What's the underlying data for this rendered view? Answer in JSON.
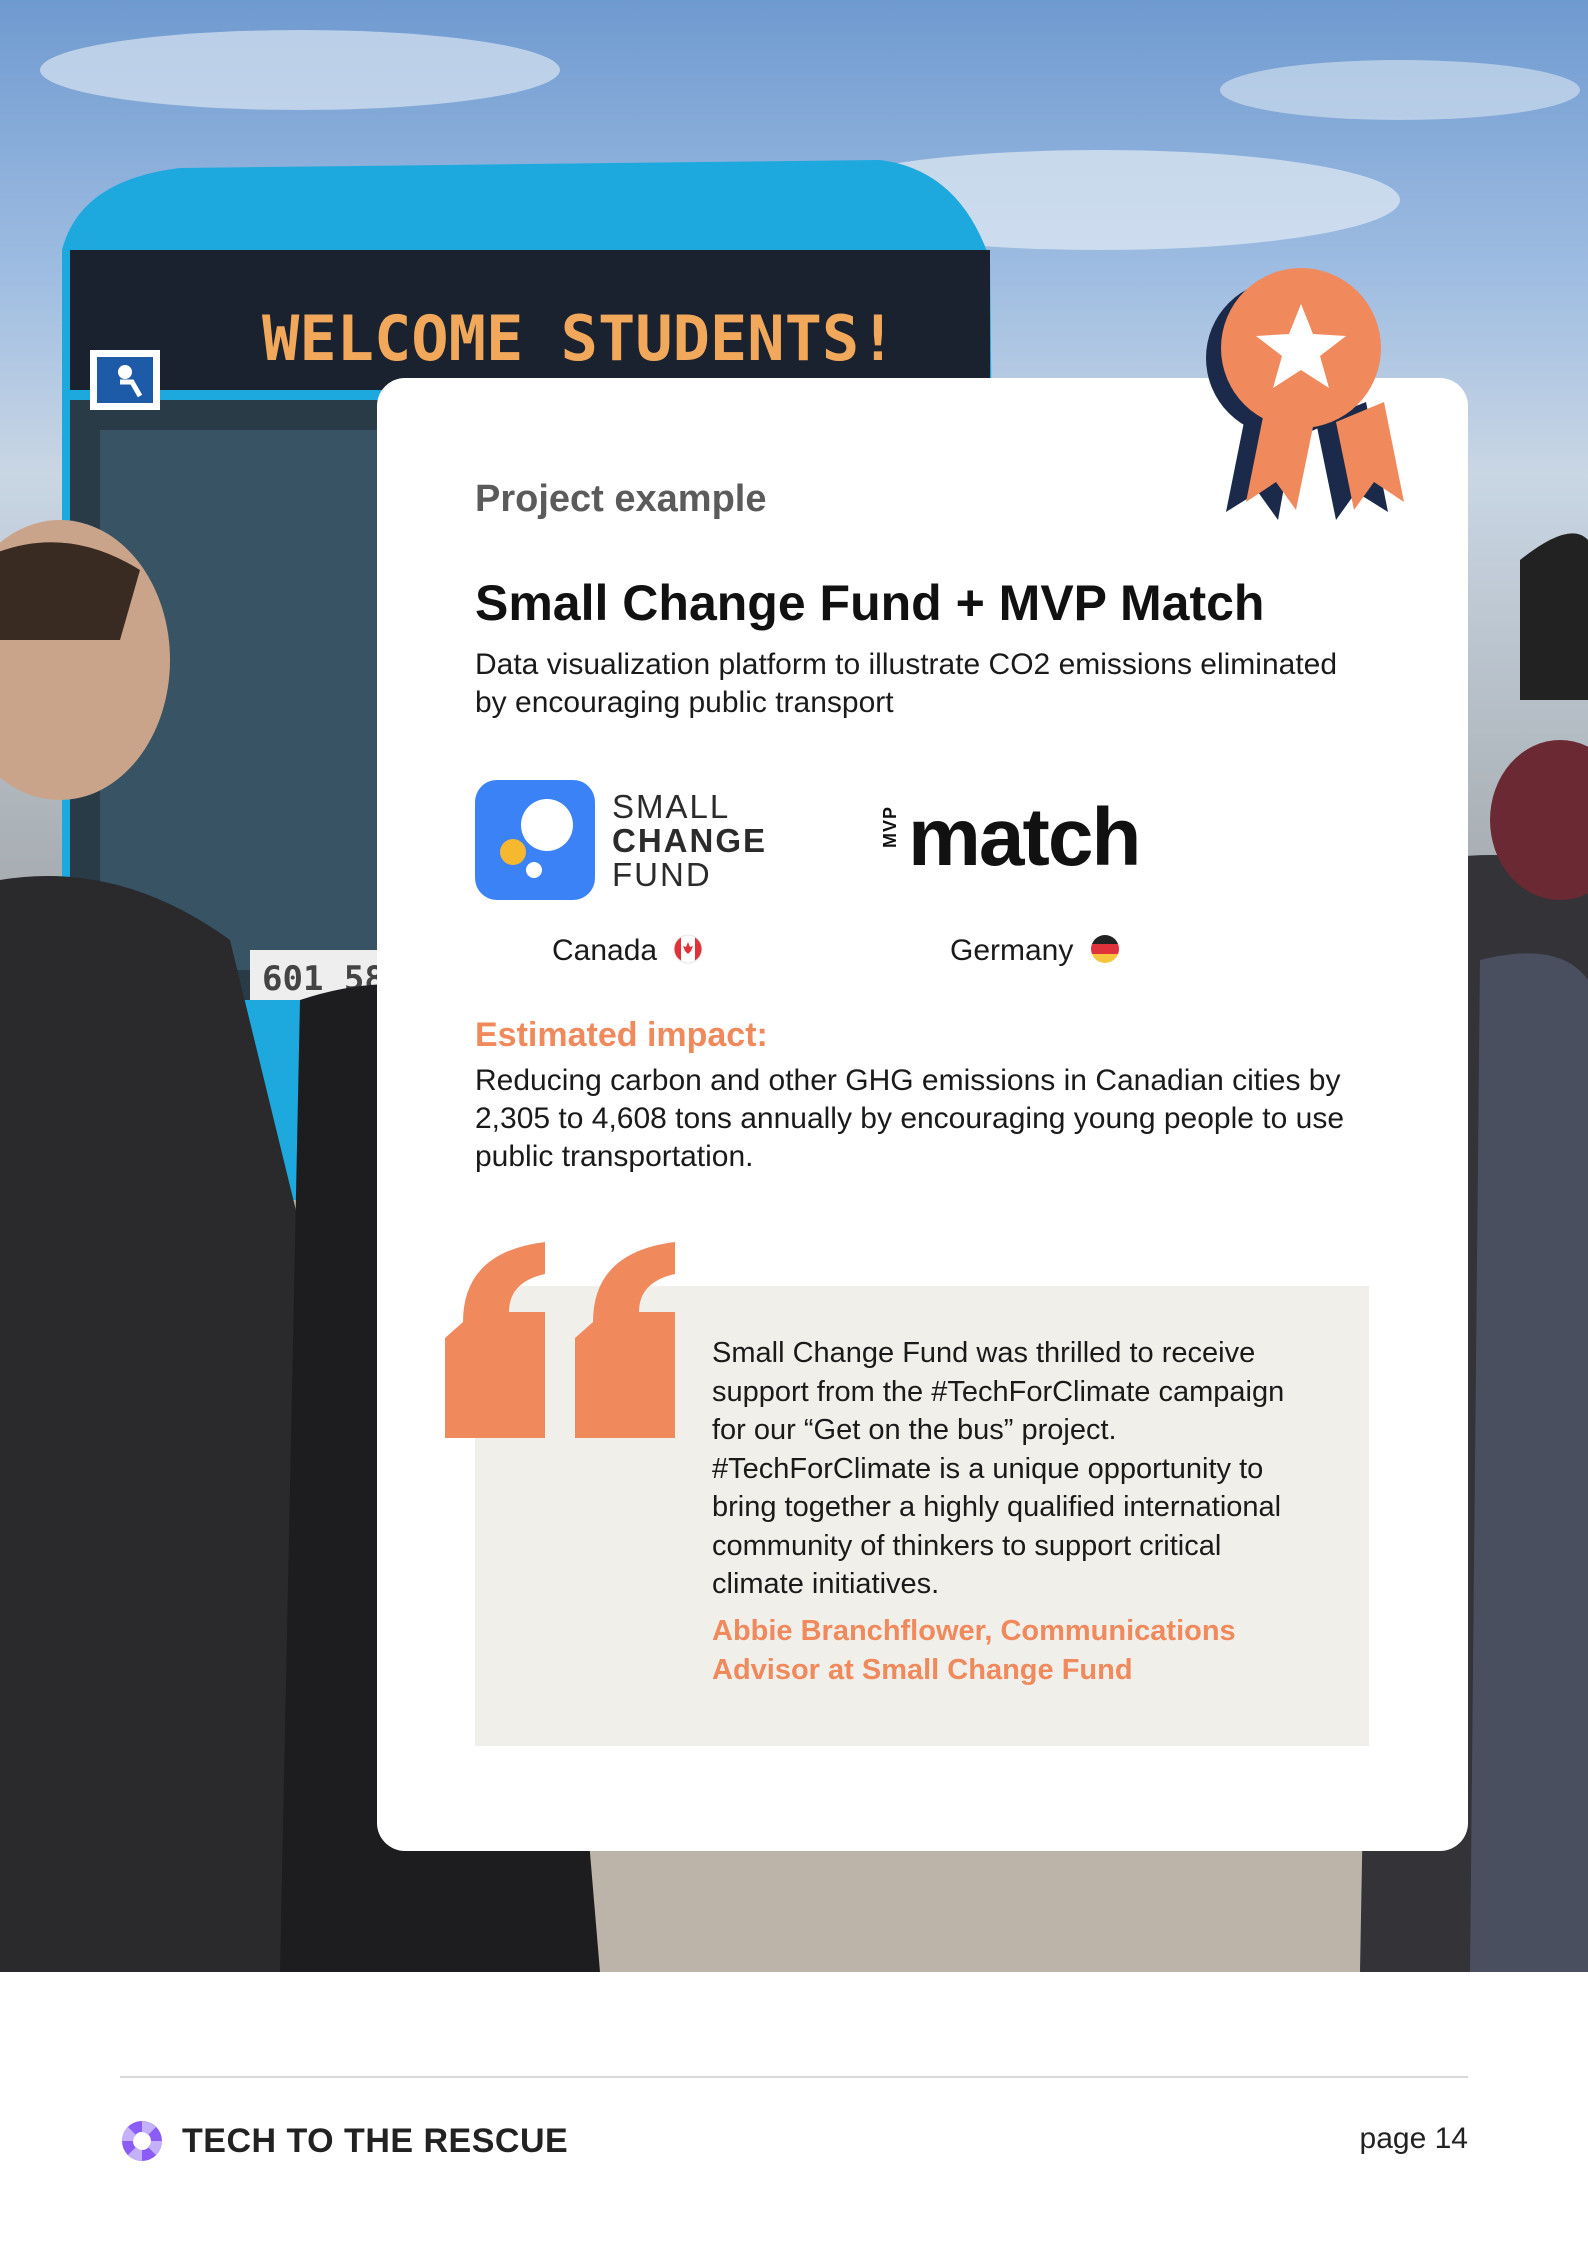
{
  "hero": {
    "bus_sign": "WELCOME STUDENTS!",
    "plate": "601 58",
    "colors": {
      "bus": "#1da9dd",
      "sign": "#f2a85a"
    }
  },
  "card": {
    "eyebrow": "Project example",
    "title": "Small Change Fund + MVP Match",
    "subtitle": "Data visualization platform to illustrate CO2 emissions eliminated by encouraging public transport",
    "partners": [
      {
        "logo_line1": "SMALL",
        "logo_line2": "CHANGE",
        "logo_line3": "FUND",
        "country": "Canada",
        "flag_icon": "canada-flag-icon"
      },
      {
        "logo_small": "MVP",
        "logo_word": "match",
        "country": "Germany",
        "flag_icon": "germany-flag-icon"
      }
    ],
    "impact_label": "Estimated impact:",
    "impact_text": "Reducing carbon and other GHG emissions in Canadian cities by 2,305 to 4,608 tons annually by encouraging young people to use public transportation.",
    "quote": {
      "text": "Small Change Fund was thrilled to receive support from the #TechForClimate campaign for our “Get on the bus” project. #TechForClimate is a unique opportunity to bring together a highly qualified international community of thinkers to support critical climate initiatives.",
      "author": "Abbie Branchflower, Communications Advisor at Small Change Fund"
    },
    "badge_icon": "award-ribbon-icon",
    "colors": {
      "accent": "#f08a5d",
      "navy": "#1b2a4a",
      "quote_bg": "#f1efea"
    }
  },
  "footer": {
    "brand": "TECH TO THE RESCUE",
    "brand_icon": "lifebuoy-icon",
    "brand_color": "#8b5cf6",
    "page": "page 14"
  }
}
